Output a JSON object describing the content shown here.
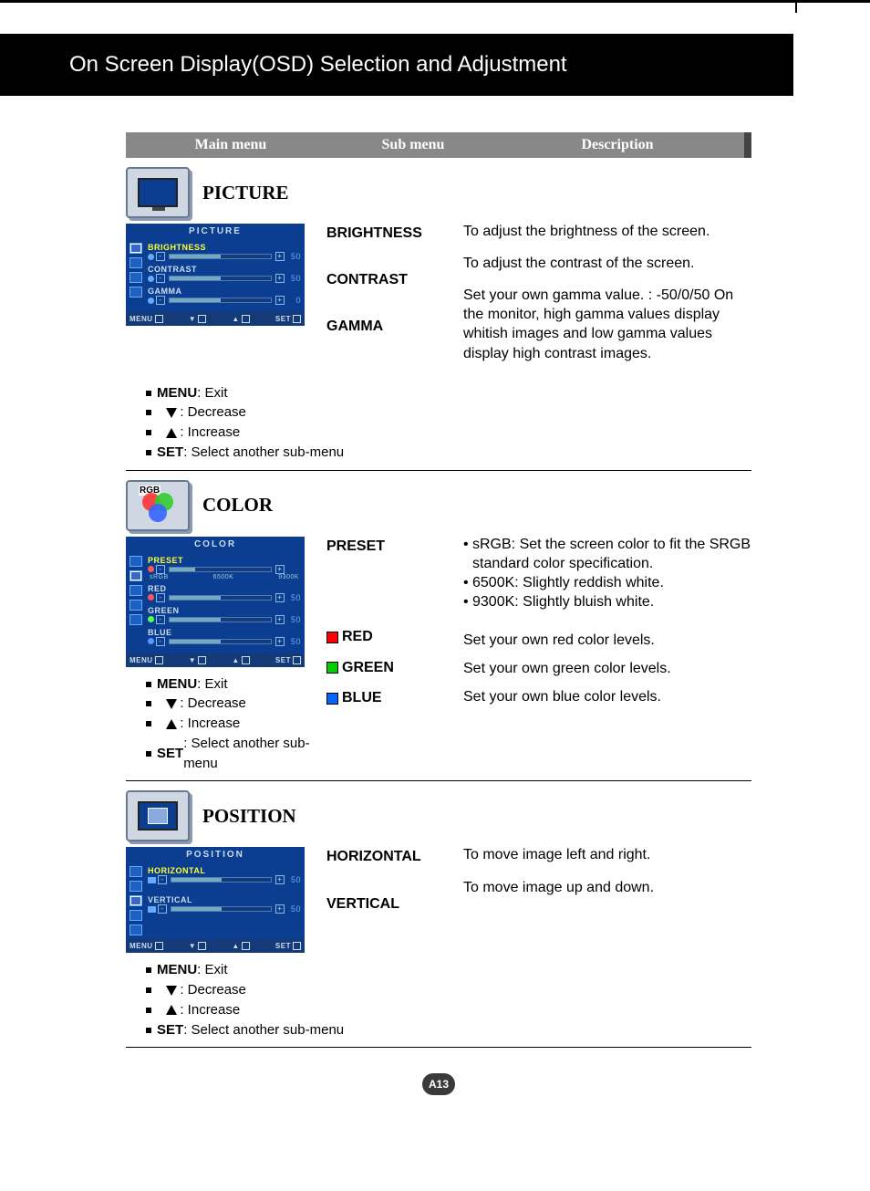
{
  "header": {
    "title": "On Screen Display(OSD) Selection and Adjustment"
  },
  "tabs": {
    "main": "Main menu",
    "sub": "Sub menu",
    "desc": "Description"
  },
  "picture": {
    "title": "PICTURE",
    "osd_title": "PICTURE",
    "rows": {
      "brightness": {
        "label": "BRIGHTNESS",
        "value": "50"
      },
      "contrast": {
        "label": "CONTRAST",
        "value": "50"
      },
      "gamma": {
        "label": "GAMMA",
        "value": "0"
      }
    },
    "sub": {
      "brightness": "BRIGHTNESS",
      "contrast": "CONTRAST",
      "gamma": "GAMMA"
    },
    "desc": {
      "brightness": "To adjust the brightness of the screen.",
      "contrast": "To adjust the contrast of the screen.",
      "gamma": "Set your own gamma value. : -50/0/50 On the monitor, high gamma values display whitish images and low gamma values display high contrast images."
    }
  },
  "color": {
    "title": "COLOR",
    "rgb_label": "RGB",
    "osd_title": "COLOR",
    "rows": {
      "preset": {
        "label": "PRESET",
        "marks": {
          "l": "sRGB",
          "m": "6500K",
          "r": "9300K"
        }
      },
      "red": {
        "label": "RED",
        "value": "50"
      },
      "green": {
        "label": "GREEN",
        "value": "50"
      },
      "blue": {
        "label": "BLUE",
        "value": "50"
      }
    },
    "sub": {
      "preset": "PRESET",
      "red": "RED",
      "green": "GREEN",
      "blue": "BLUE"
    },
    "desc": {
      "preset_srgb_l": "sRGB:",
      "preset_srgb": "Set the screen color to fit the SRGB standard color specification.",
      "preset_6500": "6500K: Slightly reddish white.",
      "preset_9300": "9300K: Slightly bluish white.",
      "red": "Set your own red color levels.",
      "green": "Set your own green color levels.",
      "blue": "Set your own blue color levels."
    }
  },
  "position": {
    "title": "POSITION",
    "osd_title": "POSITION",
    "rows": {
      "horizontal": {
        "label": "HORIZONTAL",
        "value": "50"
      },
      "vertical": {
        "label": "VERTICAL",
        "value": "50"
      }
    },
    "sub": {
      "horizontal": "HORIZONTAL",
      "vertical": "VERTICAL"
    },
    "desc": {
      "horizontal": "To move image left and right.",
      "vertical": "To move image up and down."
    }
  },
  "osd_foot": {
    "menu": "MENU",
    "down": "▼",
    "up": "▲",
    "set": "SET"
  },
  "notes": {
    "menu_l": "MENU",
    "menu": " : Exit",
    "dec": " : Decrease",
    "inc": " : Increase",
    "set_l": "SET",
    "set": " : Select another sub-menu"
  },
  "footer": {
    "page": "A13"
  }
}
